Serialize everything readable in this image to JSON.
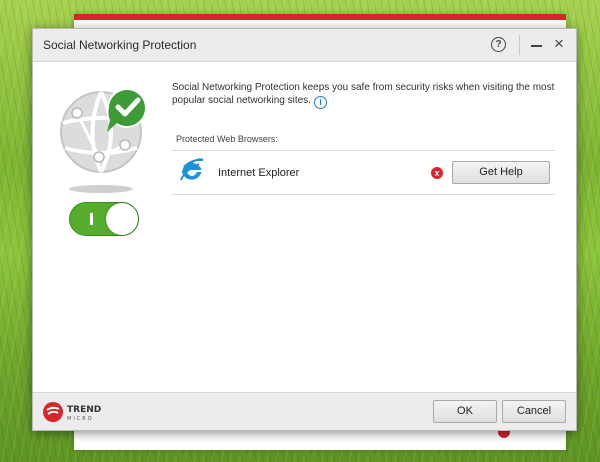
{
  "window": {
    "title": "Social Networking Protection",
    "help_label": "?",
    "close_label": "×"
  },
  "content": {
    "description": "Social Networking Protection keeps you safe from security risks when visiting the most popular social networking sites.",
    "info_label": "i",
    "toggle_state": "on",
    "toggle_label": "I"
  },
  "browsers": {
    "label": "Protected Web Browsers:",
    "items": [
      {
        "name": "Internet Explorer",
        "status": "error",
        "status_icon": "x",
        "action_label": "Get Help"
      }
    ]
  },
  "footer": {
    "logo_text_line1": "TREND",
    "logo_text_line2": "MICRO",
    "ok_label": "OK",
    "cancel_label": "Cancel"
  },
  "colors": {
    "accent_green": "#56ad2d",
    "error_red": "#d9262b",
    "brand_red": "#d4262b",
    "link_blue": "#1a7ec8"
  },
  "icons": [
    "globe-network-icon",
    "checkmark-icon",
    "info-icon",
    "internet-explorer-icon",
    "error-icon",
    "help-icon",
    "minimize-icon",
    "close-icon",
    "trend-micro-logo"
  ]
}
